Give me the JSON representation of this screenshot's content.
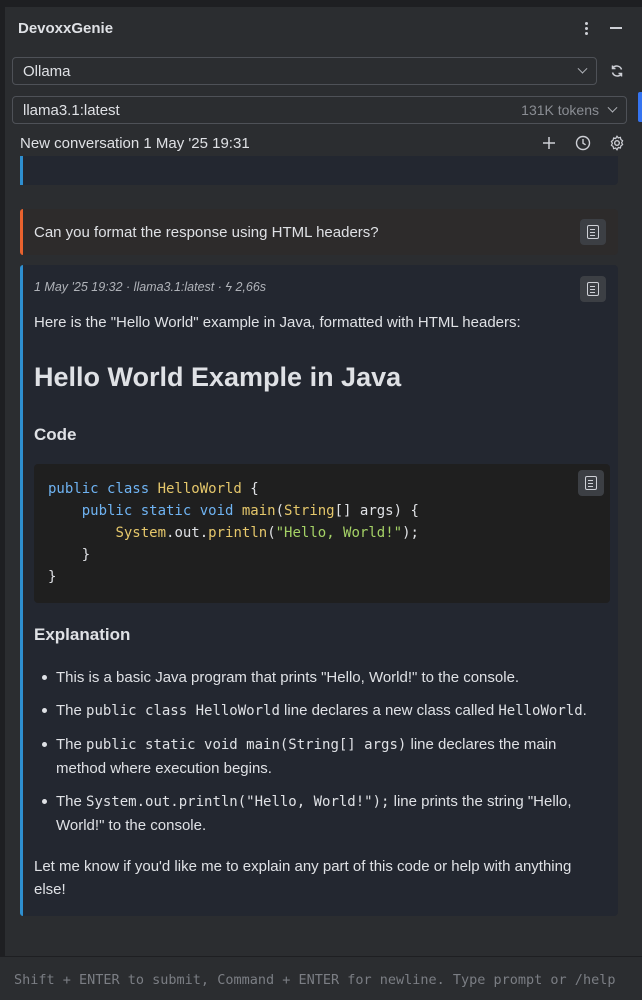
{
  "app": {
    "title": "DevoxxGenie"
  },
  "provider": {
    "selected": "Ollama"
  },
  "model": {
    "selected": "llama3.1:latest",
    "tokens": "131K tokens"
  },
  "conversation": {
    "title": "New conversation 1 May '25 19:31"
  },
  "user_message": {
    "text": "Can you format the response using HTML headers?"
  },
  "ai_message": {
    "meta": "1 May '25 19:32 · llama3.1:latest · ϟ 2,66s",
    "intro": "Here is the \"Hello World\" example in Java, formatted with HTML headers:",
    "heading": "Hello World Example in Java",
    "code_heading": "Code",
    "code_lines": [
      "public class HelloWorld {",
      "    public static void main(String[] args) {",
      "        System.out.println(\"Hello, World!\");",
      "    }",
      "}"
    ],
    "explanation_heading": "Explanation",
    "bullets": {
      "b1": "This is a basic Java program that prints \"Hello, World!\" to the console.",
      "b2_pre": "The ",
      "b2_code": "public class HelloWorld",
      "b2_mid": " line declares a new class called ",
      "b2_code2": "HelloWorld",
      "b2_post": ".",
      "b3_pre": "The ",
      "b3_code": "public static void main(String[] args)",
      "b3_post": " line declares the main method where execution begins.",
      "b4_pre": "The ",
      "b4_code": "System.out.println(\"Hello, World!\");",
      "b4_post": " line prints the string \"Hello, World!\" to the console."
    },
    "outro": "Let me know if you'd like me to explain any part of this code or help with anything else!"
  },
  "input": {
    "placeholder": "Shift + ENTER to submit, Command + ENTER for newline. Type prompt or /help"
  },
  "icons": [
    "more-vertical-icon",
    "minimize-icon",
    "chevron-down-icon",
    "refresh-icon",
    "plus-icon",
    "history-icon",
    "gear-icon",
    "copy-icon"
  ],
  "colors": {
    "user_accent": "#e8622e",
    "ai_accent": "#2e8fd0",
    "selection_accent": "#3574f0"
  }
}
